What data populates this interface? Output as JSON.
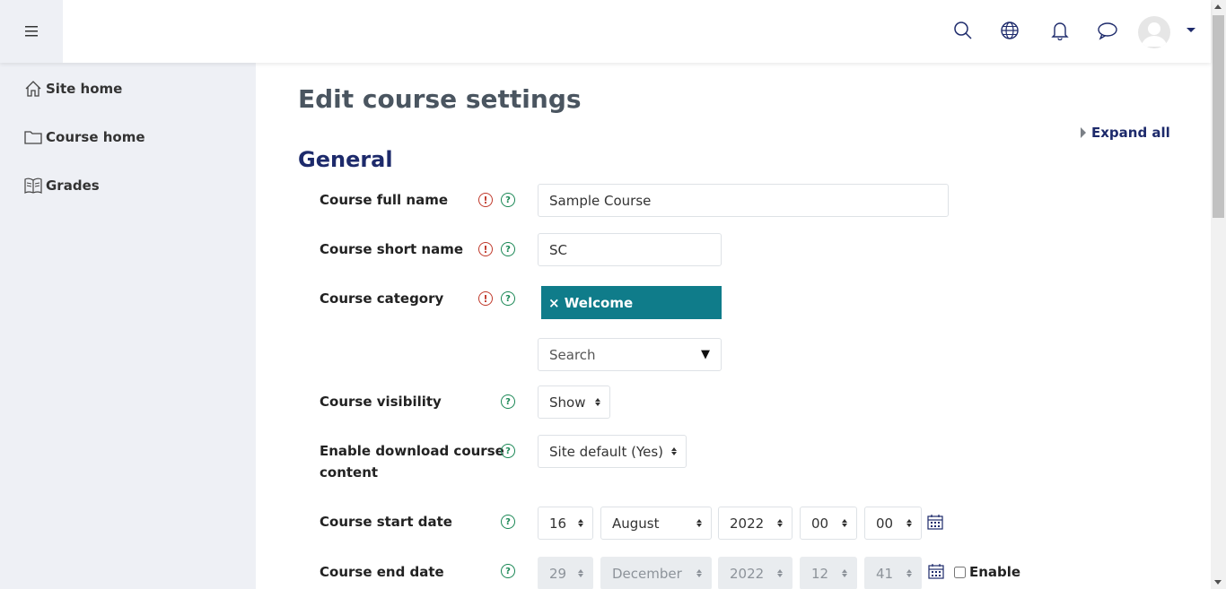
{
  "sidebar": {
    "items": [
      {
        "label": "Site home",
        "icon": "home-icon"
      },
      {
        "label": "Course home",
        "icon": "folder-icon"
      },
      {
        "label": "Grades",
        "icon": "grades-book-icon"
      }
    ]
  },
  "header": {
    "icons": [
      "menu-icon",
      "search-icon",
      "globe-icon",
      "bell-icon",
      "chat-icon",
      "avatar",
      "caret-down-icon"
    ]
  },
  "page": {
    "title": "Edit course settings",
    "expand_all": "Expand all",
    "section_title": "General"
  },
  "form": {
    "full_name": {
      "label": "Course full name",
      "value": "Sample Course"
    },
    "short_name": {
      "label": "Course short name",
      "value": "SC"
    },
    "category": {
      "label": "Course category",
      "selected_tag": "× Welcome",
      "search_placeholder": "Search"
    },
    "visibility": {
      "label": "Course visibility",
      "value": "Show"
    },
    "download": {
      "label_line1": "Enable download course",
      "label_line2": "content",
      "value": "Site default (Yes)"
    },
    "start_date": {
      "label": "Course start date",
      "day": "16",
      "month": "August",
      "year": "2022",
      "hour": "00",
      "minute": "00"
    },
    "end_date": {
      "label": "Course end date",
      "day": "29",
      "month": "December",
      "year": "2022",
      "hour": "12",
      "minute": "41",
      "enable_label": "Enable",
      "enabled": false
    }
  },
  "colors": {
    "accent_navy": "#1d2a6b",
    "tag_teal": "#0f7c8a",
    "required_red": "#c0392b",
    "help_green": "#198754",
    "sidebar_bg": "#eef0f5"
  }
}
